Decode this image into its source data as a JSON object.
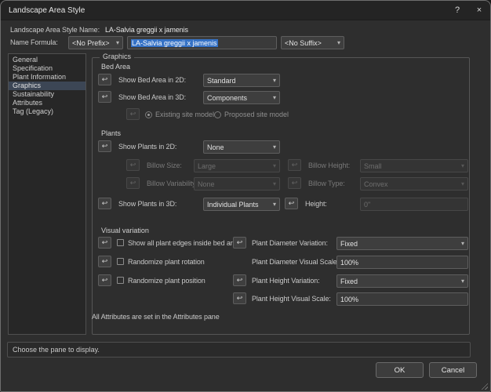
{
  "icons": {
    "caret": "▾",
    "revert": "↩",
    "help": "?",
    "close": "×"
  },
  "window": {
    "title": "Landscape Area Style"
  },
  "header": {
    "name_label": "Landscape Area Style Name:",
    "name_value": "LA-Salvia greggii x jamenis",
    "formula_label": "Name Formula:",
    "prefix_value": "<No Prefix>",
    "name_field_value": "LA-Salvia greggii x jamenis",
    "suffix_value": "<No Suffix>"
  },
  "sidebar": {
    "items": [
      {
        "label": "General",
        "selected": false
      },
      {
        "label": "Specification",
        "selected": false
      },
      {
        "label": "Plant Information",
        "selected": false
      },
      {
        "label": "Graphics",
        "selected": true
      },
      {
        "label": "Sustainability",
        "selected": false
      },
      {
        "label": "Attributes",
        "selected": false
      },
      {
        "label": "Tag (Legacy)",
        "selected": false
      }
    ]
  },
  "graphics": {
    "group_title": "Graphics",
    "bed_area": {
      "heading": "Bed Area",
      "show_2d_label": "Show Bed Area  in 2D:",
      "show_2d_value": "Standard",
      "show_3d_label": "Show Bed Area in 3D:",
      "show_3d_value": "Components",
      "existing_radio_label": "Existing site model",
      "proposed_radio_label": "Proposed site model",
      "existing_selected": true,
      "proposed_selected": false
    },
    "plants": {
      "heading": "Plants",
      "show_2d_label": "Show Plants in 2D:",
      "show_2d_value": "None",
      "billow_size_label": "Billow Size:",
      "billow_size_value": "Large",
      "billow_height_label": "Billow Height:",
      "billow_height_value": "Small",
      "billow_variability_label": "Billow Variability:",
      "billow_variability_value": "None",
      "billow_type_label": "Billow Type:",
      "billow_type_value": "Convex",
      "show_3d_label": "Show Plants in 3D:",
      "show_3d_value": "Individual Plants",
      "height_label": "Height:",
      "height_value": "0\""
    },
    "visual": {
      "heading": "Visual variation",
      "edges_label": "Show all plant edges inside bed area",
      "rotation_label": "Randomize plant rotation",
      "position_label": "Randomize plant position",
      "diam_var_label": "Plant Diameter Variation:",
      "diam_var_value": "Fixed",
      "diam_scale_label": "Plant Diameter Visual Scale:",
      "diam_scale_value": "100%",
      "height_var_label": "Plant Height Variation:",
      "height_var_value": "Fixed",
      "height_scale_label": "Plant Height Visual Scale:",
      "height_scale_value": "100%",
      "edges_checked": false,
      "rotation_checked": false,
      "position_checked": false
    },
    "note": "All Attributes are set in the Attributes pane"
  },
  "status": "Choose the pane to display.",
  "footer": {
    "ok": "OK",
    "cancel": "Cancel"
  }
}
